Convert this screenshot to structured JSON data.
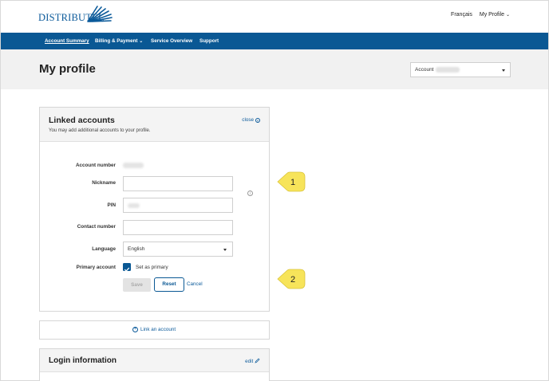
{
  "brand": {
    "name": "DISTRIBUTEL"
  },
  "top_links": {
    "language": "Français",
    "profile": "My Profile"
  },
  "nav": {
    "items": [
      {
        "label": "Account Summary",
        "active": true
      },
      {
        "label": "Billing & Payment",
        "has_dropdown": true
      },
      {
        "label": "Service Overview"
      },
      {
        "label": "Support"
      }
    ]
  },
  "header": {
    "title": "My profile",
    "account_select_label": "Account"
  },
  "linked_accounts": {
    "title": "Linked accounts",
    "subtitle": "You may add additional accounts to your profile.",
    "close_label": "close",
    "fields": {
      "account_number_label": "Account number",
      "nickname_label": "Nickname",
      "pin_label": "PIN",
      "contact_label": "Contact number",
      "language_label": "Language",
      "language_value": "English",
      "primary_label": "Primary account",
      "primary_checkbox_label": "Set as primary",
      "primary_checked": true
    },
    "buttons": {
      "save": "Save",
      "reset": "Reset",
      "cancel": "Cancel"
    }
  },
  "link_account": {
    "label": "Link an account"
  },
  "login_info": {
    "title": "Login information",
    "edit_label": "edit"
  },
  "callouts": [
    "1",
    "2"
  ],
  "colors": {
    "brand_blue": "#0a5894",
    "callout_yellow": "#f7e45a"
  }
}
